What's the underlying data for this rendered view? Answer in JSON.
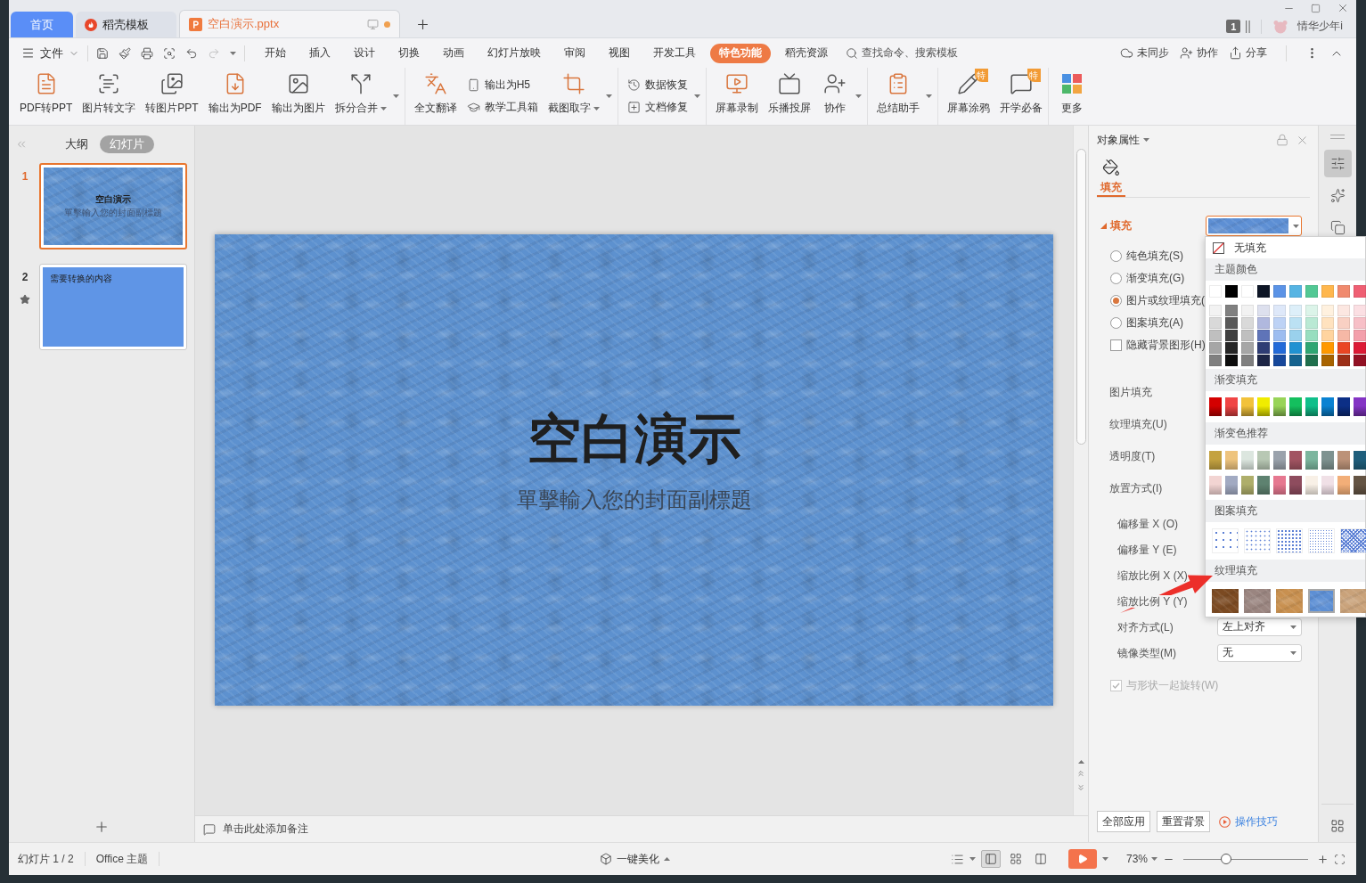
{
  "title_bar": {
    "tabs": [
      {
        "kind": "home",
        "label": "首页",
        "selected": false
      },
      {
        "kind": "docer",
        "label": "稻壳模板",
        "selected": false
      },
      {
        "kind": "document",
        "label": "空白演示.pptx",
        "selected": true,
        "modified": true
      }
    ],
    "notification_count": "1",
    "user_name": "情华少年i"
  },
  "menu_bar": {
    "file": "文件",
    "redo_disabled": true,
    "tabs": [
      {
        "label": "开始",
        "selected": false
      },
      {
        "label": "插入",
        "selected": false
      },
      {
        "label": "设计",
        "selected": false
      },
      {
        "label": "切换",
        "selected": false
      },
      {
        "label": "动画",
        "selected": false
      },
      {
        "label": "幻灯片放映",
        "selected": false
      },
      {
        "label": "审阅",
        "selected": false
      },
      {
        "label": "视图",
        "selected": false
      },
      {
        "label": "开发工具",
        "selected": false
      },
      {
        "label": "特色功能",
        "selected": true
      },
      {
        "label": "稻壳资源",
        "selected": false
      }
    ],
    "search": {
      "placeholder": "查找命令、搜索模板"
    },
    "actions": [
      "未同步",
      "协作",
      "分享"
    ]
  },
  "ribbon": {
    "groups": [
      {
        "expander": true,
        "items": [
          {
            "kind": "large",
            "label": "PDF转PPT"
          },
          {
            "kind": "large",
            "label": "图片转文字"
          },
          {
            "kind": "large",
            "label": "转图片PPT"
          },
          {
            "kind": "large",
            "label": "输出为PDF"
          },
          {
            "kind": "large",
            "label": "输出为图片"
          },
          {
            "kind": "large",
            "label": "拆分合并",
            "dropdown": true
          }
        ]
      },
      {
        "expander": true,
        "items": [
          {
            "kind": "large",
            "label": "全文翻译"
          },
          {
            "kind": "stack",
            "children": [
              {
                "label": "输出为H5"
              },
              {
                "label": "教学工具箱"
              }
            ]
          },
          {
            "kind": "large",
            "label": "截图取字",
            "dropdown": true
          }
        ]
      },
      {
        "expander": true,
        "items": [
          {
            "kind": "stack",
            "children": [
              {
                "label": "数据恢复"
              },
              {
                "label": "文档修复"
              }
            ]
          }
        ]
      },
      {
        "expander": true,
        "items": [
          {
            "kind": "large",
            "label": "屏幕录制"
          },
          {
            "kind": "large",
            "label": "乐播投屏"
          },
          {
            "kind": "large",
            "label": "协作"
          }
        ]
      },
      {
        "expander": true,
        "items": [
          {
            "kind": "large",
            "label": "总结助手"
          }
        ]
      },
      {
        "items": [
          {
            "kind": "large",
            "label": "屏幕涂鸦",
            "badge": "特"
          },
          {
            "kind": "large",
            "label": "开学必备",
            "badge": "特"
          }
        ]
      },
      {
        "items": [
          {
            "kind": "large",
            "label": "更多"
          }
        ]
      }
    ]
  },
  "slides_panel": {
    "views": [
      {
        "label": "大纲",
        "selected": false
      },
      {
        "label": "幻灯片",
        "selected": true
      }
    ],
    "slides": [
      {
        "number": "1",
        "kind": "cover",
        "selected": true,
        "title": "空白演示",
        "subtitle": "單擊輸入您的封面副標題"
      },
      {
        "number": "2",
        "kind": "content",
        "selected": false,
        "animated": true,
        "title": "需要转换的内容"
      }
    ]
  },
  "slide": {
    "title": "空白演示",
    "subtitle": "單擊輸入您的封面副標題"
  },
  "notes": {
    "placeholder": "单击此处添加备注"
  },
  "properties": {
    "title": "对象属性",
    "tab": {
      "label": "填充",
      "selected": true
    },
    "section": {
      "label": "填充",
      "expanded": true
    },
    "fill_picker": {
      "expanded": true
    },
    "fill_options": [
      {
        "kind": "radio",
        "label": "纯色填充(S)",
        "selected": false
      },
      {
        "kind": "radio",
        "label": "渐变填充(G)",
        "selected": false
      },
      {
        "kind": "radio",
        "label": "图片或纹理填充(",
        "selected": true
      },
      {
        "kind": "radio",
        "label": "图案填充(A)",
        "selected": false
      },
      {
        "kind": "checkbox",
        "label": "隐藏背景图形(H)",
        "checked": false
      }
    ],
    "settings": [
      {
        "kind": "label",
        "label": "图片填充"
      },
      {
        "kind": "label",
        "label": "纹理填充(U)"
      },
      {
        "kind": "label",
        "label": "透明度(T)"
      },
      {
        "kind": "label",
        "label": "放置方式(I)",
        "children": [
          {
            "kind": "label",
            "label": "偏移量 X (O)"
          },
          {
            "kind": "label",
            "label": "偏移量 Y (E)"
          },
          {
            "kind": "label",
            "label": "缩放比例 X (X)"
          },
          {
            "kind": "label",
            "label": "缩放比例 Y (Y)"
          },
          {
            "kind": "select",
            "label": "对齐方式(L)",
            "value": "左上对齐"
          },
          {
            "kind": "select",
            "label": "镜像类型(M)",
            "value": "无"
          }
        ]
      }
    ],
    "rotate_with_shape": {
      "label": "与形状一起旋转(W)",
      "checked": true,
      "disabled": true
    },
    "buttons": [
      "全部应用",
      "重置背景"
    ],
    "help_link": "操作技巧"
  },
  "side_tools": [
    {
      "selected": true
    },
    {
      "selected": false
    },
    {
      "selected": false
    }
  ],
  "fill_menu": {
    "no_fill": "无填充",
    "theme": {
      "title": "主题颜色",
      "base": [
        {
          "color": "#ffffff"
        },
        {
          "color": "#000000"
        },
        {
          "color": "#ffffff"
        },
        {
          "color": "#0e1626"
        },
        {
          "color": "#5b93e6"
        },
        {
          "color": "#56b4e3"
        },
        {
          "color": "#52c894"
        },
        {
          "color": "#ffb74d"
        },
        {
          "color": "#f08a6e"
        },
        {
          "color": "#ef5f73"
        }
      ],
      "shades": [
        [
          {
            "color": "#f2f2f2"
          },
          {
            "color": "#808080"
          },
          {
            "color": "#f2f2f2"
          },
          {
            "color": "#dde0ee"
          },
          {
            "color": "#dee8f9"
          },
          {
            "color": "#ddeff9"
          },
          {
            "color": "#dcf4e9"
          },
          {
            "color": "#fff1df"
          },
          {
            "color": "#fce7e1"
          },
          {
            "color": "#fbdfe3"
          }
        ],
        [
          {
            "color": "#d9d9d9"
          },
          {
            "color": "#595959"
          },
          {
            "color": "#d9d9d9"
          },
          {
            "color": "#b0b8de"
          },
          {
            "color": "#bdd2f5"
          },
          {
            "color": "#bbe1f3"
          },
          {
            "color": "#b9e9d4"
          },
          {
            "color": "#ffe2bf"
          },
          {
            "color": "#f9d0c3"
          },
          {
            "color": "#f7bfc7"
          }
        ],
        [
          {
            "color": "#bfbfbf"
          },
          {
            "color": "#404040"
          },
          {
            "color": "#bfbfbf"
          },
          {
            "color": "#5f74b8"
          },
          {
            "color": "#9dbdf0"
          },
          {
            "color": "#9ad1ec"
          },
          {
            "color": "#97debf"
          },
          {
            "color": "#ffd49f"
          },
          {
            "color": "#f6b8a6"
          },
          {
            "color": "#f39fab"
          }
        ],
        [
          {
            "color": "#a6a6a6"
          },
          {
            "color": "#262626"
          },
          {
            "color": "#a6a6a6"
          },
          {
            "color": "#2f3d74"
          },
          {
            "color": "#236ad8"
          },
          {
            "color": "#2092d2"
          },
          {
            "color": "#2fa673"
          },
          {
            "color": "#ff9800"
          },
          {
            "color": "#ea4623"
          },
          {
            "color": "#dc1a36"
          }
        ],
        [
          {
            "color": "#808080"
          },
          {
            "color": "#0d0d0d"
          },
          {
            "color": "#808080"
          },
          {
            "color": "#1d2545"
          },
          {
            "color": "#17489b"
          },
          {
            "color": "#16638f"
          },
          {
            "color": "#1f6f4d"
          },
          {
            "color": "#a86300"
          },
          {
            "color": "#9c2f17"
          },
          {
            "color": "#921124"
          }
        ]
      ]
    },
    "gradients": {
      "title": "渐变填充",
      "swatches": [
        {
          "color": "#d40000"
        },
        {
          "color": "#f04545"
        },
        {
          "color": "#f2c23a"
        },
        {
          "color": "#f0ec00"
        },
        {
          "color": "#98d458"
        },
        {
          "color": "#14bf5e"
        },
        {
          "color": "#10bf8a"
        },
        {
          "color": "#0a82d2"
        },
        {
          "color": "#0c2f86"
        },
        {
          "color": "#8434c4"
        }
      ]
    },
    "recommended": {
      "title": "渐变色推荐",
      "rows": [
        [
          {
            "color": "#c4a240"
          },
          {
            "color": "#eec47e"
          },
          {
            "color": "#dce6df"
          },
          {
            "color": "#b8c8b4"
          },
          {
            "color": "#9aa2ac"
          },
          {
            "color": "#a25462"
          },
          {
            "color": "#7cb69e"
          },
          {
            "color": "#7e9290"
          },
          {
            "color": "#bc9278"
          },
          {
            "color": "#1e5e7c"
          }
        ],
        [
          {
            "color": "#f2d4d2"
          },
          {
            "color": "#a2aac2"
          },
          {
            "color": "#aeae6a"
          },
          {
            "color": "#5e8270"
          },
          {
            "color": "#e67890"
          },
          {
            "color": "#8e4c5e"
          },
          {
            "color": "#f8f0e6"
          },
          {
            "color": "#f0e0e6"
          },
          {
            "color": "#f2ae78"
          },
          {
            "color": "#645444"
          }
        ]
      ]
    },
    "patterns": {
      "title": "图案填充",
      "swatches": [
        {
          "selected": false
        },
        {
          "selected": false
        },
        {
          "selected": false
        },
        {
          "selected": false
        },
        {
          "selected": false
        }
      ]
    },
    "textures": {
      "title": "纹理填充",
      "swatches": [
        {
          "color": "#7b4a22",
          "selected": false
        },
        {
          "color": "#9a8580",
          "selected": false
        },
        {
          "color": "#c89050",
          "selected": false
        },
        {
          "color": "#5d8fd4",
          "selected": true
        },
        {
          "color": "#c9a27a",
          "selected": false
        }
      ]
    }
  },
  "status_bar": {
    "slide_counter": "幻灯片 1 / 2",
    "theme": "Office 主题",
    "beautify": "一键美化",
    "views": [
      {
        "kind": "normal",
        "selected": true
      },
      {
        "kind": "sorter",
        "selected": false
      },
      {
        "kind": "reading",
        "selected": false
      }
    ],
    "zoom": "73%",
    "zoom_slider": {
      "level": 0.34
    }
  }
}
